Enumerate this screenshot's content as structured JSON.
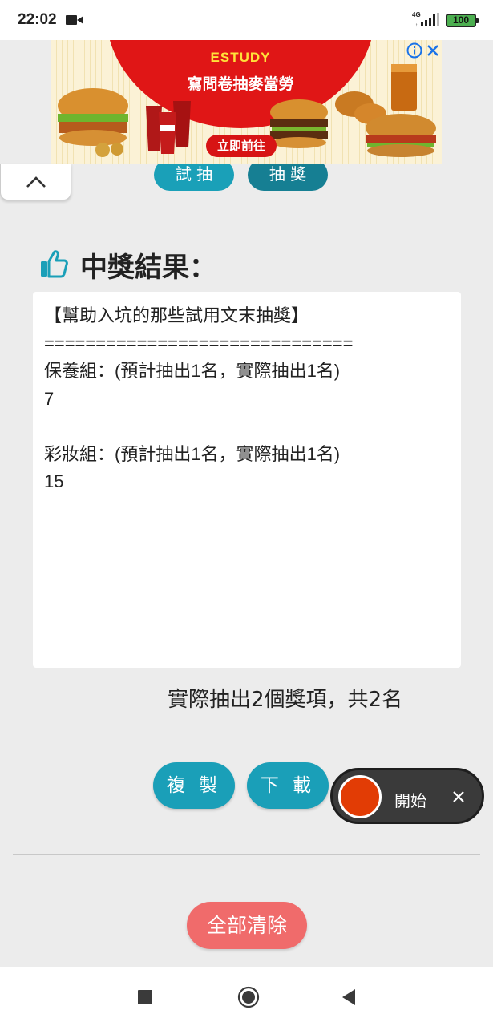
{
  "status_bar": {
    "time": "22:02",
    "network_label": "4G",
    "battery_level": "100",
    "icons": [
      "camera-icon",
      "signal-icon",
      "battery-icon"
    ],
    "battery_color": "#4caf50"
  },
  "ad": {
    "brand": "ESTUDY",
    "title": "寫問卷抽麥當勞",
    "cta": "立即前往",
    "icons": [
      "info-icon",
      "close-icon"
    ],
    "colors": {
      "arc": "#e01616",
      "cta": "#d71414"
    }
  },
  "top_buttons": {
    "trial_draw_label": "試 抽",
    "draw_label": "抽 獎"
  },
  "results": {
    "title": "中獎結果：",
    "icon": "thumbs-up-icon",
    "lines": [
      "【幫助入坑的那些試用文末抽獎】",
      "==============================",
      "保養組：(預計抽出1名，實際抽出1名)",
      "7",
      "",
      "彩妝組：(預計抽出1名，實際抽出1名)",
      "15"
    ],
    "summary": "實際抽出2個獎項，共2名"
  },
  "actions": {
    "copy_label": "複 製",
    "download_label": "下 載",
    "clear_all_label": "全部清除",
    "colors": {
      "primary": "#1a9fb8",
      "danger": "#f06b6b"
    }
  },
  "recorder": {
    "start_label": "開始",
    "record_color": "#e23c05"
  },
  "navbar": {
    "icons": [
      "recents-icon",
      "home-icon",
      "back-icon"
    ]
  }
}
